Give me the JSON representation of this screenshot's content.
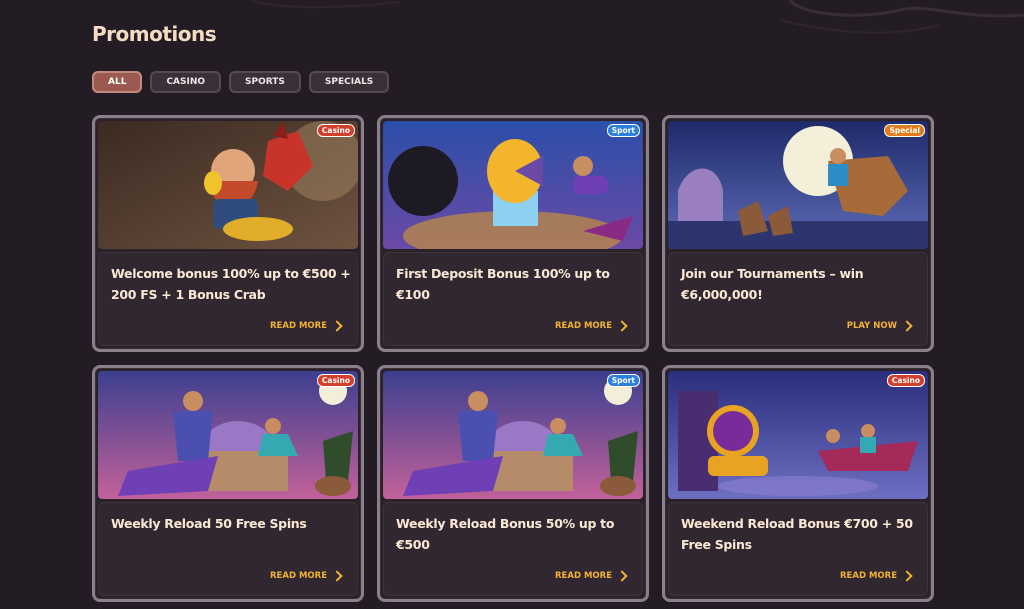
{
  "page": {
    "title": "Promotions"
  },
  "filters": [
    "ALL",
    "CASINO",
    "SPORTS",
    "SPECIALS"
  ],
  "cards": [
    {
      "badge": "Casino",
      "title": "Welcome bonus 100% up to €500 + 200 FS + 1 Bonus Crab",
      "cta": "READ MORE",
      "art": "dwarf-dragon"
    },
    {
      "badge": "Sport",
      "title": "First Deposit Bonus 100% up to €100",
      "cta": "READ MORE",
      "art": "golden-disc"
    },
    {
      "badge": "Special",
      "title": "Join our Tournaments – win €6,000,000!",
      "cta": "PLAY NOW",
      "art": "desert-riders"
    },
    {
      "badge": "Casino",
      "title": "Weekly Reload 50 Free Spins",
      "cta": "READ MORE",
      "art": "magic-carpet"
    },
    {
      "badge": "Sport",
      "title": "Weekly Reload Bonus 50% up to €500",
      "cta": "READ MORE",
      "art": "magic-carpet"
    },
    {
      "badge": "Casino",
      "title": "Weekend Reload Bonus €700 + 50 Free Spins",
      "cta": "READ MORE",
      "art": "drops-wins"
    }
  ],
  "colors": {
    "accent": "#f2b233",
    "active_filter": "#9a5a50",
    "background": "#241c24"
  }
}
